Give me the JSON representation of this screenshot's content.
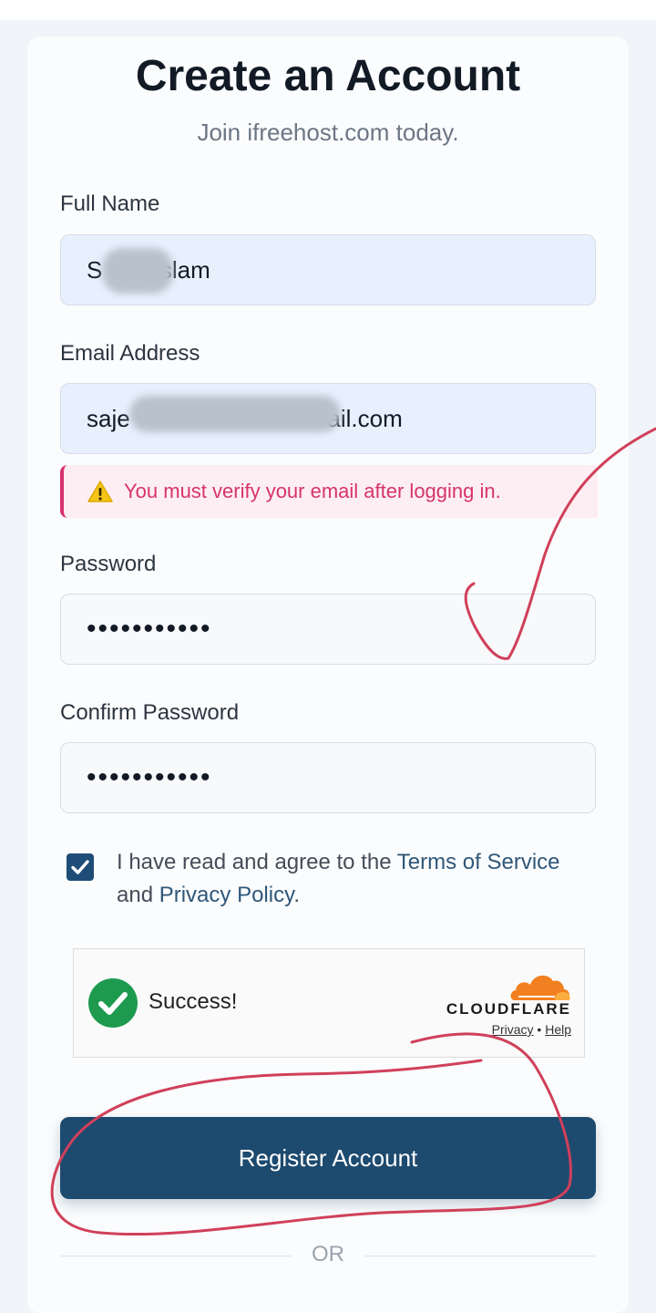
{
  "header": {
    "title": "Create an Account",
    "subtitle": "Join ifreehost.com today."
  },
  "form": {
    "full_name": {
      "label": "Full Name",
      "value": "S        islam"
    },
    "email": {
      "label": "Email Address",
      "value": "saje                              ail.com"
    },
    "email_notice": "You must verify your email after logging in.",
    "password": {
      "label": "Password",
      "value": "•••••••••••"
    },
    "confirm_password": {
      "label": "Confirm Password",
      "value": "•••••••••••"
    },
    "agree": {
      "checked": true,
      "prefix": "I have read and agree to the ",
      "terms": "Terms of Service",
      "middle": " and ",
      "privacy": "Privacy Policy",
      "suffix": "."
    },
    "captcha": {
      "status": "Success!",
      "brand": "CLOUDFLARE",
      "privacy_link": "Privacy",
      "separator": "•",
      "help_link": "Help"
    },
    "submit_label": "Register Account",
    "divider_label": "OR"
  },
  "colors": {
    "primary": "#1d4a6f",
    "alert": "#d6336c",
    "success": "#1e9a4f",
    "cloudflare": "#f38020",
    "annotation": "#d0405a"
  }
}
